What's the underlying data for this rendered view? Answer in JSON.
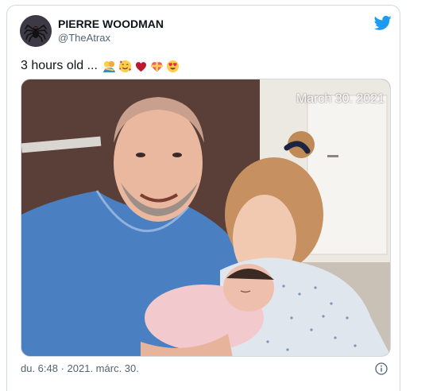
{
  "tweet": {
    "author": {
      "display_name": "PIERRE WOODMAN",
      "handle": "@TheAtrax",
      "avatar_icon": "spider-icon"
    },
    "text": "3 hours old ...",
    "emojis": [
      "people-hugging-emoji",
      "smiling-face-with-hearts-emoji",
      "red-heart-emoji",
      "heart-with-ribbon-emoji",
      "heart-eyes-emoji"
    ],
    "photo": {
      "date_stamp": "March 30. 2021"
    },
    "timestamp": "du. 6:48 · 2021. márc. 30.",
    "brand_icon": "twitter-bird-icon",
    "info_icon": "info-icon"
  },
  "colors": {
    "brand": "#1d9bf0",
    "text_primary": "#0f1419",
    "text_secondary": "#536471",
    "border": "#cfd9de"
  }
}
